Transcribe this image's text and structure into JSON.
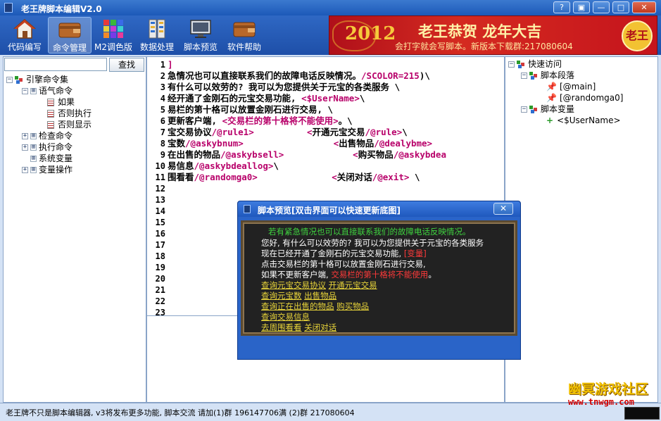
{
  "app": {
    "title": "老王牌脚本编辑V2.0",
    "window_buttons": [
      "?",
      "▣",
      "—",
      "□",
      "✕"
    ]
  },
  "toolbar": {
    "items": [
      {
        "label": "代码编写",
        "icon": "house-icon"
      },
      {
        "label": "命令管理",
        "icon": "wallet-icon"
      },
      {
        "label": "M2调色版",
        "icon": "palette-grid-icon"
      },
      {
        "label": "数据处理",
        "icon": "stack-icon"
      },
      {
        "label": "脚本预览",
        "icon": "monitor-icon"
      },
      {
        "label": "软件帮助",
        "icon": "wallet-help-icon"
      }
    ]
  },
  "banner": {
    "year": "2012",
    "headline": "老王恭贺 龙年大吉",
    "subline": "会打字就会写脚本。新版本下载群:217080604",
    "seal": "老王"
  },
  "search": {
    "value": "",
    "button": "查找"
  },
  "command_tree": [
    {
      "label": "引擎命令集",
      "toggle": "−",
      "depth": 0,
      "icon": "tree-icon"
    },
    {
      "label": "语气命令",
      "toggle": "−",
      "depth": 1,
      "icon": "toggle"
    },
    {
      "label": "如果",
      "depth": 2,
      "icon": "page-icon"
    },
    {
      "label": "否则执行",
      "depth": 2,
      "icon": "page-icon"
    },
    {
      "label": "否则显示",
      "depth": 2,
      "icon": "page-icon"
    },
    {
      "label": "检查命令",
      "toggle": "+",
      "depth": 1,
      "icon": "toggle"
    },
    {
      "label": "执行命令",
      "toggle": "+",
      "depth": 1,
      "icon": "toggle"
    },
    {
      "label": "系统变量",
      "depth": 1,
      "icon": "toggle"
    },
    {
      "label": "变量操作",
      "toggle": "+",
      "depth": 1,
      "icon": "toggle"
    }
  ],
  "editor": {
    "line_numbers": [
      "1",
      "2",
      "3",
      "4",
      "5",
      "6",
      "7",
      "8",
      "9",
      "10",
      "11",
      "12",
      "13",
      "14",
      "15",
      "16",
      "17",
      "18",
      "19",
      "20",
      "21",
      "22",
      "23"
    ],
    "lines": [
      [
        {
          "t": "]",
          "c": "tag"
        }
      ],
      [
        {
          "t": "急情况也可以直接联系我们的故障电话反映情况。",
          "c": "cmd"
        },
        {
          "t": "/SCOLOR=215",
          "c": "tag"
        },
        {
          "t": ")\\",
          "c": "cmd"
        }
      ],
      [
        {
          "t": "有什么可以效劳的? 我可以为您提供关于元宝的各类服务 \\",
          "c": "cmd"
        }
      ],
      [
        {
          "t": "经开通了金刚石的元宝交易功能, ",
          "c": "cmd"
        },
        {
          "t": "<$UserName>",
          "c": "tag"
        },
        {
          "t": "\\",
          "c": "cmd"
        }
      ],
      [
        {
          "t": "易栏的第十格可以放置金刚石进行交易, \\",
          "c": "cmd"
        }
      ],
      [
        {
          "t": "更新客户端, ",
          "c": "cmd"
        },
        {
          "t": "<交易栏的第十格将不能使用>",
          "c": "tag"
        },
        {
          "t": "。\\",
          "c": "cmd"
        }
      ],
      [
        {
          "t": "宝交易协议",
          "c": "cmd"
        },
        {
          "t": "/@rule1>",
          "c": "tag"
        },
        {
          "t": "          ",
          "c": "cmd"
        },
        {
          "t": "<",
          "c": "tag"
        },
        {
          "t": "开通元宝交易",
          "c": "cmd"
        },
        {
          "t": "/@rule>",
          "c": "tag"
        },
        {
          "t": "\\",
          "c": "cmd"
        }
      ],
      [
        {
          "t": "宝数",
          "c": "cmd"
        },
        {
          "t": "/@askybnum>",
          "c": "tag"
        },
        {
          "t": "                 ",
          "c": "cmd"
        },
        {
          "t": "<",
          "c": "tag"
        },
        {
          "t": "出售物品",
          "c": "cmd"
        },
        {
          "t": "/@dealybme>",
          "c": "tag"
        }
      ],
      [
        {
          "t": "在出售的物品",
          "c": "cmd"
        },
        {
          "t": "/@askybsell>",
          "c": "tag"
        },
        {
          "t": "             ",
          "c": "cmd"
        },
        {
          "t": "<",
          "c": "tag"
        },
        {
          "t": "购买物品",
          "c": "cmd"
        },
        {
          "t": "/@askybdea",
          "c": "tag"
        }
      ],
      [
        {
          "t": "易信息",
          "c": "cmd"
        },
        {
          "t": "/@askybdeallog>",
          "c": "tag"
        },
        {
          "t": "\\",
          "c": "cmd"
        }
      ],
      [
        {
          "t": "围看看",
          "c": "cmd"
        },
        {
          "t": "/@randomga0>",
          "c": "tag"
        },
        {
          "t": "              ",
          "c": "cmd"
        },
        {
          "t": "<",
          "c": "tag"
        },
        {
          "t": "关闭对话",
          "c": "cmd"
        },
        {
          "t": "/@exit>",
          "c": "tag"
        },
        {
          "t": " \\",
          "c": "cmd"
        }
      ]
    ]
  },
  "quick_access": [
    {
      "label": "快速访问",
      "toggle": "−",
      "depth": 0,
      "icon": "tree-icon"
    },
    {
      "label": "脚本段落",
      "toggle": "−",
      "depth": 1,
      "icon": "tree-icon"
    },
    {
      "label": "[@main]",
      "depth": 2,
      "icon": "pin-icon"
    },
    {
      "label": "[@randomga0]",
      "depth": 2,
      "icon": "pin-icon"
    },
    {
      "label": "脚本变量",
      "toggle": "−",
      "depth": 1,
      "icon": "tree-icon"
    },
    {
      "label": "<$UserName>",
      "depth": 2,
      "icon": "plus-icon"
    }
  ],
  "preview": {
    "title": "脚本预览[双击界面可以快速更新底图]",
    "close": "✕",
    "lines": [
      [
        {
          "t": "若有紧急情况也可以直接联系我们的故障电话反映情况。",
          "c": "g"
        }
      ],
      [
        {
          "t": "您好, 有什么可以效劳的? 我可以为您提供关于元宝的各类服务",
          "c": "w"
        }
      ],
      [
        {
          "t": "现在已经开通了金刚石的元宝交易功能, ",
          "c": "w"
        },
        {
          "t": "[变量]",
          "c": "r"
        }
      ],
      [
        {
          "t": "点击交易栏的第十格可以放置金刚石进行交易, ",
          "c": "w"
        }
      ],
      [
        {
          "t": "如果不更新客户端, ",
          "c": "w"
        },
        {
          "t": "交易栏的第十格将不能使用",
          "c": "r"
        },
        {
          "t": "。",
          "c": "w"
        }
      ],
      [
        {
          "t": "查询元宝交易协议",
          "c": "y"
        },
        {
          "t": "  ",
          "c": "w"
        },
        {
          "t": "开通元宝交易",
          "c": "y"
        }
      ],
      [
        {
          "t": "查询元宝数",
          "c": "y"
        },
        {
          "t": "  ",
          "c": "w"
        },
        {
          "t": "出售物品",
          "c": "y"
        }
      ],
      [
        {
          "t": "查询正在出售的物品",
          "c": "y"
        },
        {
          "t": " ",
          "c": "w"
        },
        {
          "t": "购买物品",
          "c": "y"
        }
      ],
      [
        {
          "t": "查询交易信息",
          "c": "y"
        }
      ],
      [
        {
          "t": "去周围看看",
          "c": "y"
        },
        {
          "t": "  ",
          "c": "w"
        },
        {
          "t": "关闭对话",
          "c": "y"
        }
      ]
    ]
  },
  "status": {
    "text": "老王牌不只是脚本编辑器, v3将发布更多功能, 脚本交流 请加(1)群 196147706满 (2)群 217080604"
  },
  "watermark": {
    "line1": "幽冥游戏社区",
    "line2": "www.tnwgm.com"
  },
  "colors": {
    "titlebar": "#2a64c8",
    "tag": "#b8006a",
    "preview_green": "#3fd23f",
    "preview_red": "#ff3a3a",
    "preview_link": "#e8d43a"
  }
}
